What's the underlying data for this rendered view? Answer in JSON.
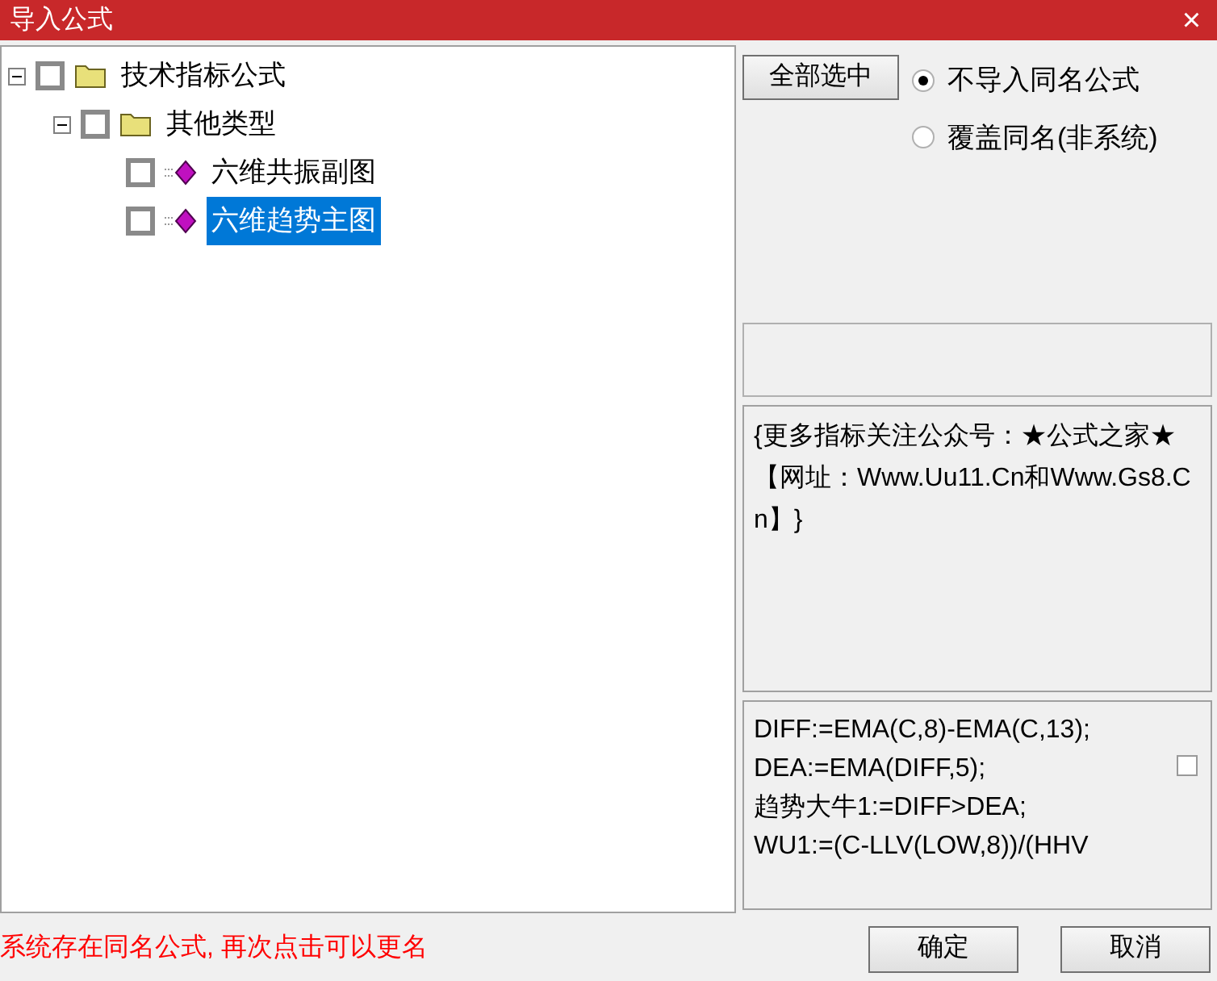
{
  "window": {
    "title": "导入公式",
    "close": "×"
  },
  "tree": [
    {
      "label": "技术指标公式",
      "kind": "folder",
      "checked": false,
      "selected": false,
      "expanded": true,
      "children": [
        {
          "label": "其他类型",
          "kind": "folder",
          "checked": false,
          "selected": false,
          "expanded": true,
          "children": [
            {
              "label": "六维共振副图",
              "kind": "formula",
              "checked": false,
              "selected": false
            },
            {
              "label": "六维趋势主图",
              "kind": "formula",
              "checked": false,
              "selected": true
            }
          ]
        }
      ]
    }
  ],
  "select_all_button": "全部选中",
  "options": [
    {
      "label": "不导入同名公式",
      "selected": true
    },
    {
      "label": "覆盖同名(非系统)",
      "selected": false
    }
  ],
  "description": "{更多指标关注公众号：★公式之家★ 【网址：Www.Uu11.Cn和Www.Gs8.Cn】}",
  "code": {
    "lines": [
      "DIFF:=EMA(C,8)-EMA(C,13);",
      "DEA:=EMA(DIFF,5);",
      "趋势大牛1:=DIFF>DEA;",
      "WU1:=(C-LLV(LOW,8))/(HHV"
    ],
    "checked": false
  },
  "status_message": "系统存在同名公式, 再次点击可以更名",
  "buttons": [
    "确定",
    "取消"
  ]
}
